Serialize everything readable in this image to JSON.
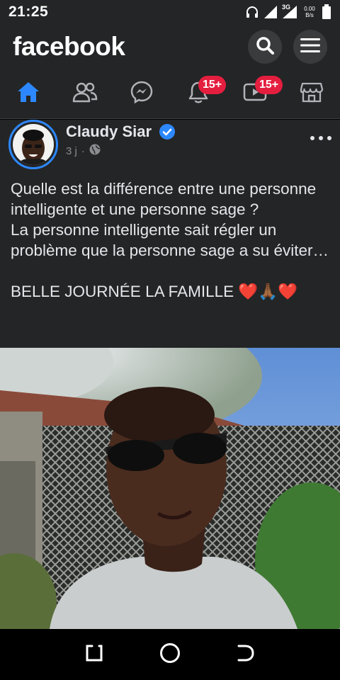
{
  "status_bar": {
    "time": "21:25",
    "network_type": "3G",
    "net_speed_value": "0.00",
    "net_speed_unit": "B/s",
    "icons": [
      "headphones-icon",
      "signal-icon",
      "signal-3g-icon",
      "battery-icon"
    ]
  },
  "header": {
    "logo": "facebook",
    "actions": [
      "search-icon",
      "menu-icon"
    ]
  },
  "tabs": [
    {
      "name": "home",
      "icon": "home-icon",
      "active": true,
      "badge": ""
    },
    {
      "name": "friends",
      "icon": "friends-icon",
      "active": false,
      "badge": ""
    },
    {
      "name": "messenger",
      "icon": "messenger-icon",
      "active": false,
      "badge": ""
    },
    {
      "name": "notifications",
      "icon": "bell-icon",
      "active": false,
      "badge": "15+"
    },
    {
      "name": "watch",
      "icon": "video-icon",
      "active": false,
      "badge": "15+"
    },
    {
      "name": "marketplace",
      "icon": "shop-icon",
      "active": false,
      "badge": ""
    }
  ],
  "post": {
    "author": "Claudy Siar",
    "verified": true,
    "time": "3 j",
    "separator": "·",
    "audience_icon": "globe-icon",
    "text_lines": [
      "Quelle est la différence entre une personne intelligente et une personne sage ?",
      "La personne intelligente sait régler un problème que la personne sage a su éviter…",
      "",
      "BELLE JOURNÉE LA FAMILLE ❤️🙏🏾❤️"
    ]
  },
  "nav_bar": {
    "buttons": [
      "recent-apps-icon",
      "home-circle-icon",
      "back-icon"
    ]
  },
  "colors": {
    "background": "#242526",
    "accent": "#2d88ff",
    "badge": "#e41e3f",
    "text": "#e4e6eb",
    "secondary_text": "#8a8d91"
  }
}
